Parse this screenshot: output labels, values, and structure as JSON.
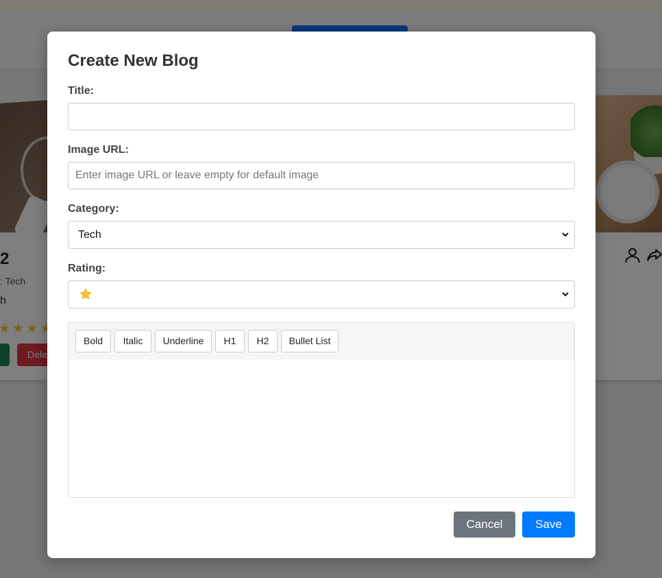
{
  "background": {
    "cards": [
      {
        "title": "2",
        "category": ": Tech",
        "author": "h",
        "stars": "★★★★",
        "delete_label": "Dele"
      },
      {
        "title": "",
        "category": "",
        "author": ""
      }
    ],
    "icons": [
      "user-icon",
      "share-icon"
    ]
  },
  "modal": {
    "title": "Create New Blog",
    "fields": {
      "title": {
        "label": "Title:",
        "value": "",
        "placeholder": ""
      },
      "image_url": {
        "label": "Image URL:",
        "value": "",
        "placeholder": "Enter image URL or leave empty for default image"
      },
      "category": {
        "label": "Category:",
        "selected": "Tech"
      },
      "rating": {
        "label": "Rating:",
        "selected_icon": "star-icon",
        "star_color": "#f4c430"
      }
    },
    "toolbar": {
      "bold": "Bold",
      "italic": "Italic",
      "underline": "Underline",
      "h1": "H1",
      "h2": "H2",
      "bullet_list": "Bullet List"
    },
    "editor_content": "",
    "actions": {
      "cancel": "Cancel",
      "save": "Save"
    }
  },
  "colors": {
    "primary": "#007bff",
    "secondary": "#6c757d",
    "danger": "#dc3545",
    "success": "#198754"
  }
}
